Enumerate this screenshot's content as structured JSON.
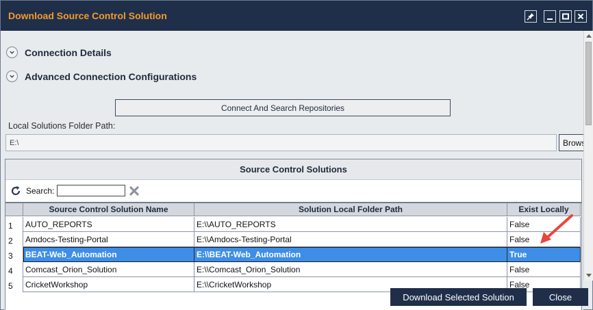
{
  "window": {
    "title": "Download Source Control Solution",
    "buttons": [
      {
        "name": "pin-icon"
      },
      {
        "name": "minimize-icon"
      },
      {
        "name": "maximize-icon"
      },
      {
        "name": "close-icon"
      }
    ]
  },
  "sections": {
    "connection_details": "Connection Details",
    "advanced_config": "Advanced Connection Configurations"
  },
  "connect_button": "Connect And Search Repositories",
  "local_path": {
    "label": "Local Solutions Folder Path:",
    "value": "E:\\",
    "browse_label": "Browse"
  },
  "solutions_panel": {
    "title": "Source Control Solutions",
    "search_label": "Search:",
    "search_value": "",
    "columns": [
      "Source Control Solution Name",
      "Solution Local Folder Path",
      "Exist Locally"
    ],
    "rows": [
      {
        "num": "1",
        "name": "AUTO_REPORTS",
        "path": "E:\\\\AUTO_REPORTS",
        "exists": "False"
      },
      {
        "num": "2",
        "name": "Amdocs-Testing-Portal",
        "path": "E:\\\\Amdocs-Testing-Portal",
        "exists": "False"
      },
      {
        "num": "3",
        "name": "BEAT-Web_Automation",
        "path": "E:\\\\BEAT-Web_Automation",
        "exists": "True"
      },
      {
        "num": "4",
        "name": "Comcast_Orion_Solution",
        "path": "E:\\\\Comcast_Orion_Solution",
        "exists": "False"
      },
      {
        "num": "5",
        "name": "CricketWorkshop",
        "path": "E:\\\\CricketWorkshop",
        "exists": "False"
      }
    ],
    "selected_row": 3
  },
  "footer": {
    "download_label": "Download Selected Solution",
    "close_label": "Close"
  },
  "colors": {
    "titlebar": "#1f2f4a",
    "title_text": "#f29b2b",
    "selection": "#3e8ee8",
    "annotation_arrow": "#e8473c"
  }
}
